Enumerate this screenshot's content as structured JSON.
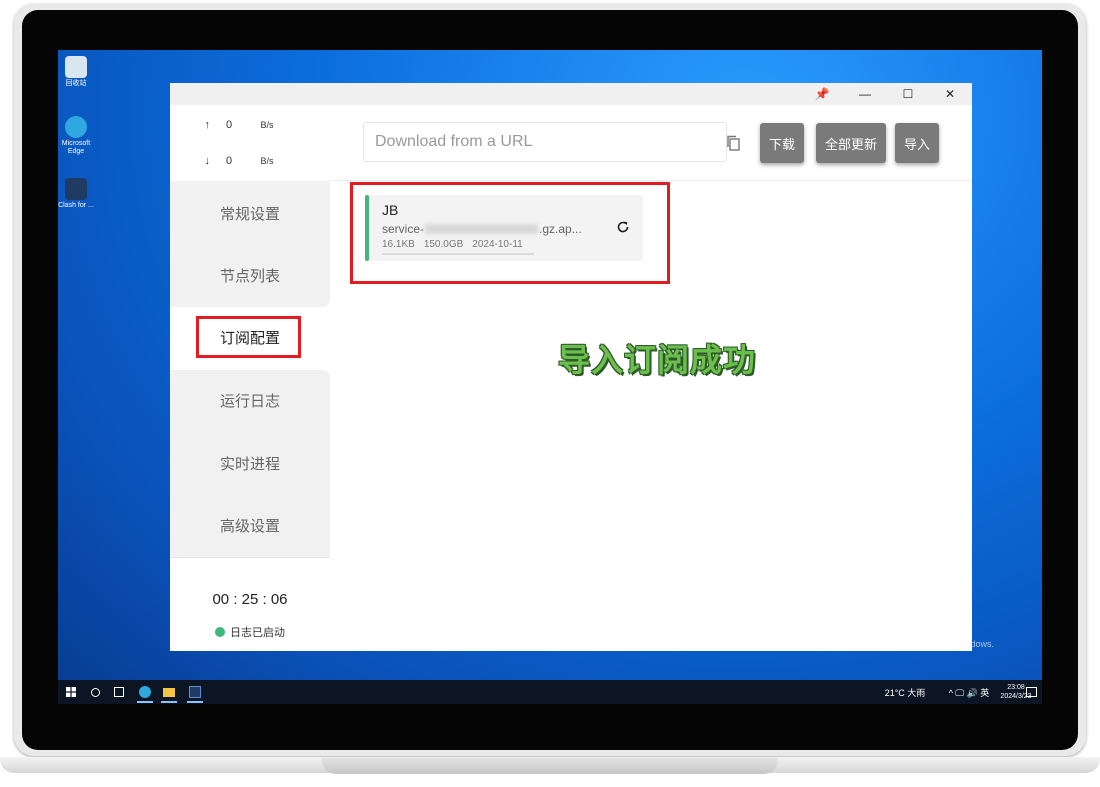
{
  "desktop": {
    "icons": [
      {
        "label": "回收站",
        "icon": "recycle-bin-icon",
        "color": "#d8e6f2"
      },
      {
        "label": "Microsoft Edge",
        "icon": "edge-icon",
        "color": "#2fa8e0"
      },
      {
        "label": "Clash for ...",
        "icon": "cat-icon",
        "color": "#1f3a63"
      }
    ],
    "watermark": "dows."
  },
  "window": {
    "controls": {
      "pin": "📌",
      "minimize": "—",
      "maximize": "☐",
      "close": "✕"
    },
    "speed": {
      "up": {
        "arrow": "↑",
        "value": "0",
        "unit": "B/s"
      },
      "down": {
        "arrow": "↓",
        "value": "0",
        "unit": "B/s"
      }
    },
    "menu": [
      {
        "label": "常规设置"
      },
      {
        "label": "节点列表"
      },
      {
        "label": "订阅配置"
      },
      {
        "label": "运行日志"
      },
      {
        "label": "实时进程"
      },
      {
        "label": "高级设置"
      }
    ],
    "uptime": "00 : 25 : 06",
    "log_status": {
      "label": "日志已启动",
      "color": "#3fb87e"
    },
    "toolbar": {
      "url_placeholder": "Download from a URL",
      "download_label": "下载",
      "update_all_label": "全部更新",
      "import_label": "导入"
    },
    "subscription": {
      "name": "JB",
      "url_prefix": "service-",
      "url_suffix": ".gz.ap...",
      "size": "16.1KB",
      "quota": "150.0GB",
      "date": "2024-10-11"
    },
    "success_message": "导入订阅成功"
  },
  "taskbar": {
    "weather": "21°C 大雨",
    "tray": "^ 🖵 🔊 英",
    "time": "23:08",
    "date": "2024/3/23"
  },
  "colors": {
    "accent": "#3fb87e",
    "highlight": "#e21c21",
    "button": "#7a7a7a"
  }
}
